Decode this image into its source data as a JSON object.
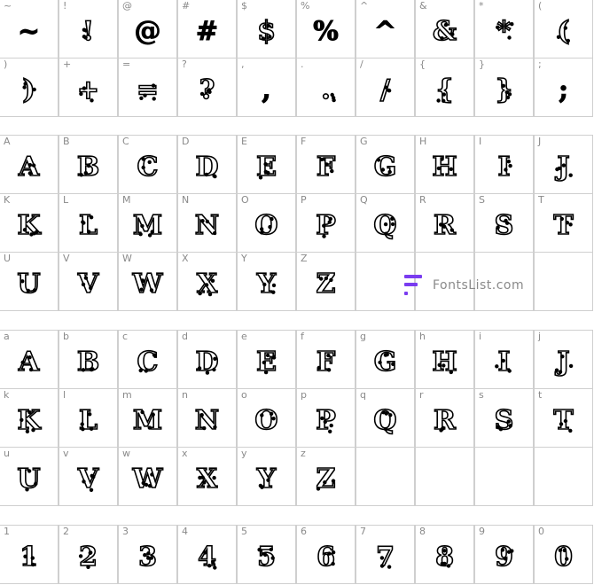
{
  "sections": [
    {
      "id": "punctuation",
      "cells": [
        {
          "key": "~",
          "glyph": "~",
          "style": "solid"
        },
        {
          "key": "!",
          "glyph": "!",
          "style": "stencil"
        },
        {
          "key": "@",
          "glyph": "@",
          "style": "solid"
        },
        {
          "key": "#",
          "glyph": "#",
          "style": "solid"
        },
        {
          "key": "$",
          "glyph": "$",
          "style": "stencil"
        },
        {
          "key": "%",
          "glyph": "%",
          "style": "solid"
        },
        {
          "key": "^",
          "glyph": "^",
          "style": "solid"
        },
        {
          "key": "&",
          "glyph": "&",
          "style": "stencil"
        },
        {
          "key": "*",
          "glyph": "*",
          "style": "stencil"
        },
        {
          "key": "(",
          "glyph": "(",
          "style": "stencil"
        },
        {
          "key": ")",
          "glyph": ")",
          "style": "stencil"
        },
        {
          "key": "+",
          "glyph": "+",
          "style": "stencil"
        },
        {
          "key": "=",
          "glyph": "=",
          "style": "stencil"
        },
        {
          "key": "?",
          "glyph": "?",
          "style": "stencil"
        },
        {
          "key": ",",
          "glyph": ",",
          "style": "solid"
        },
        {
          "key": ".",
          "glyph": ".",
          "style": "stencil"
        },
        {
          "key": "/",
          "glyph": "/",
          "style": "stencil"
        },
        {
          "key": "{",
          "glyph": "{",
          "style": "stencil"
        },
        {
          "key": "}",
          "glyph": "}",
          "style": "stencil"
        },
        {
          "key": ";",
          "glyph": ";",
          "style": "solid"
        }
      ]
    },
    {
      "id": "uppercase",
      "cells": [
        {
          "key": "A",
          "glyph": "A"
        },
        {
          "key": "B",
          "glyph": "B"
        },
        {
          "key": "C",
          "glyph": "C"
        },
        {
          "key": "D",
          "glyph": "D"
        },
        {
          "key": "E",
          "glyph": "E"
        },
        {
          "key": "F",
          "glyph": "F"
        },
        {
          "key": "G",
          "glyph": "G"
        },
        {
          "key": "H",
          "glyph": "H"
        },
        {
          "key": "I",
          "glyph": "I"
        },
        {
          "key": "J",
          "glyph": "J"
        },
        {
          "key": "K",
          "glyph": "K"
        },
        {
          "key": "L",
          "glyph": "L"
        },
        {
          "key": "M",
          "glyph": "M"
        },
        {
          "key": "N",
          "glyph": "N"
        },
        {
          "key": "O",
          "glyph": "O"
        },
        {
          "key": "P",
          "glyph": "P"
        },
        {
          "key": "Q",
          "glyph": "Q"
        },
        {
          "key": "R",
          "glyph": "R"
        },
        {
          "key": "S",
          "glyph": "S"
        },
        {
          "key": "T",
          "glyph": "T"
        },
        {
          "key": "U",
          "glyph": "U"
        },
        {
          "key": "V",
          "glyph": "V"
        },
        {
          "key": "W",
          "glyph": "W"
        },
        {
          "key": "X",
          "glyph": "X"
        },
        {
          "key": "Y",
          "glyph": "Y"
        },
        {
          "key": "Z",
          "glyph": "Z"
        }
      ]
    },
    {
      "id": "lowercase",
      "cells": [
        {
          "key": "a",
          "glyph": "A"
        },
        {
          "key": "b",
          "glyph": "B"
        },
        {
          "key": "c",
          "glyph": "C"
        },
        {
          "key": "d",
          "glyph": "D"
        },
        {
          "key": "e",
          "glyph": "E"
        },
        {
          "key": "f",
          "glyph": "F"
        },
        {
          "key": "g",
          "glyph": "G"
        },
        {
          "key": "h",
          "glyph": "H"
        },
        {
          "key": "i",
          "glyph": "I"
        },
        {
          "key": "j",
          "glyph": "J"
        },
        {
          "key": "k",
          "glyph": "K"
        },
        {
          "key": "l",
          "glyph": "L"
        },
        {
          "key": "m",
          "glyph": "M"
        },
        {
          "key": "n",
          "glyph": "N"
        },
        {
          "key": "o",
          "glyph": "O"
        },
        {
          "key": "p",
          "glyph": "P"
        },
        {
          "key": "q",
          "glyph": "Q"
        },
        {
          "key": "r",
          "glyph": "R"
        },
        {
          "key": "s",
          "glyph": "S"
        },
        {
          "key": "t",
          "glyph": "T"
        },
        {
          "key": "u",
          "glyph": "U"
        },
        {
          "key": "v",
          "glyph": "V"
        },
        {
          "key": "w",
          "glyph": "W"
        },
        {
          "key": "x",
          "glyph": "X"
        },
        {
          "key": "y",
          "glyph": "Y"
        },
        {
          "key": "z",
          "glyph": "Z"
        }
      ]
    },
    {
      "id": "digits",
      "cells": [
        {
          "key": "1",
          "glyph": "1"
        },
        {
          "key": "2",
          "glyph": "2"
        },
        {
          "key": "3",
          "glyph": "3"
        },
        {
          "key": "4",
          "glyph": "4"
        },
        {
          "key": "5",
          "glyph": "5"
        },
        {
          "key": "6",
          "glyph": "6"
        },
        {
          "key": "7",
          "glyph": "7"
        },
        {
          "key": "8",
          "glyph": "8"
        },
        {
          "key": "9",
          "glyph": "9"
        },
        {
          "key": "0",
          "glyph": "0"
        }
      ]
    }
  ],
  "brand": {
    "text": "FontsList.com",
    "accent": "#7a3cf0",
    "icon": "fontslist-logo-icon"
  },
  "colors": {
    "grid_border": "#cfcfcf",
    "key_label": "#8a8a8a",
    "glyph": "#000000"
  }
}
